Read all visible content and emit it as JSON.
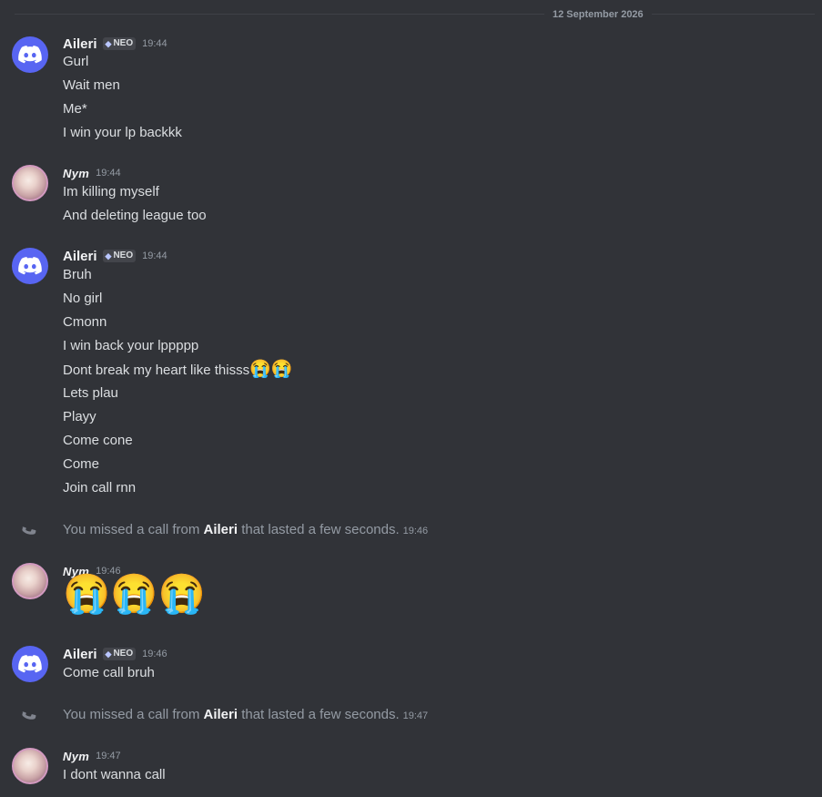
{
  "date_divider": "12 September 2026",
  "messages": [
    {
      "author": "Aileri",
      "badge": "NEO",
      "time": "19:44",
      "lines": [
        "Gurl",
        "Wait men",
        "Me*",
        "I win your lp backkk"
      ]
    },
    {
      "author": "Nym",
      "time": "19:44",
      "lines": [
        "Im killing myself",
        "And deleting league too"
      ]
    },
    {
      "author": "Aileri",
      "badge": "NEO",
      "time": "19:44",
      "lines": [
        "Bruh",
        "No girl",
        "Cmonn",
        "I win back your lppppp",
        "Dont break my heart like thisss",
        "Lets plau",
        "Playy",
        "Come cone",
        "Come",
        "Join call rnn"
      ],
      "emoji_after_line_5": "😭😭"
    },
    {
      "system": true,
      "prefix": "You missed a call from ",
      "caller": "Aileri",
      "suffix": " that lasted a few seconds.",
      "time": "19:46"
    },
    {
      "author": "Nym",
      "time": "19:46",
      "jumbo_emoji": "😭😭😭"
    },
    {
      "author": "Aileri",
      "badge": "NEO",
      "time": "19:46",
      "lines": [
        "Come call bruh"
      ]
    },
    {
      "system": true,
      "prefix": "You missed a call from ",
      "caller": "Aileri",
      "suffix": " that lasted a few seconds.",
      "time": "19:47"
    },
    {
      "author": "Nym",
      "time": "19:47",
      "lines": [
        "I dont wanna call"
      ]
    }
  ],
  "icons": {
    "discord_avatar": "discord-logo-icon",
    "missed_call": "phone-icon",
    "badge_gem": "gem-icon"
  },
  "colors": {
    "background": "#313338",
    "blurple": "#5865f2",
    "muted": "#949ba4"
  }
}
